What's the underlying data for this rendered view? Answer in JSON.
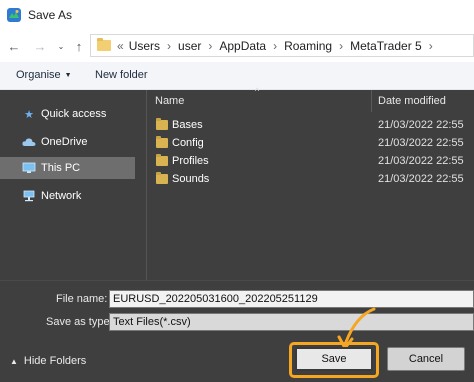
{
  "window": {
    "title": "Save As",
    "app_icon": "metatrader-app-icon"
  },
  "navigation": {
    "back_icon": "arrow-left-icon",
    "forward_icon": "arrow-right-icon",
    "recent_icon": "chevron-down-icon",
    "up_icon": "arrow-up-icon"
  },
  "address": {
    "overflow": "«",
    "crumbs": [
      "Users",
      "user",
      "AppData",
      "Roaming",
      "MetaTrader 5"
    ],
    "separator": "›",
    "chevron": "›"
  },
  "toolbar": {
    "organise_label": "Organise",
    "organise_caret": "▼",
    "new_folder_label": "New folder"
  },
  "sidebar": {
    "items": [
      {
        "label": "Quick access",
        "icon": "star-icon",
        "selected": false
      },
      {
        "label": "OneDrive",
        "icon": "cloud-icon",
        "selected": false
      },
      {
        "label": "This PC",
        "icon": "monitor-icon",
        "selected": true
      },
      {
        "label": "Network",
        "icon": "network-icon",
        "selected": false
      }
    ]
  },
  "file_list": {
    "columns": {
      "name": "Name",
      "date": "Date modified"
    },
    "sort_indicator": "^",
    "rows": [
      {
        "name": "Bases",
        "date": "21/03/2022 22:55"
      },
      {
        "name": "Config",
        "date": "21/03/2022 22:55"
      },
      {
        "name": "Profiles",
        "date": "21/03/2022 22:55"
      },
      {
        "name": "Sounds",
        "date": "21/03/2022 22:55"
      }
    ]
  },
  "form": {
    "file_name_label": "File name:",
    "file_name_value": "EURUSD_202205031600_202205251129",
    "save_type_label": "Save as type:",
    "save_type_value": "Text Files(*.csv)"
  },
  "footer": {
    "hide_folders_icon": "▲",
    "hide_folders_label": "Hide Folders",
    "save_label": "Save",
    "cancel_label": "Cancel"
  },
  "colors": {
    "highlight": "#f5a623",
    "overlay": "#3f3f3f",
    "folder": "#d9b351"
  }
}
